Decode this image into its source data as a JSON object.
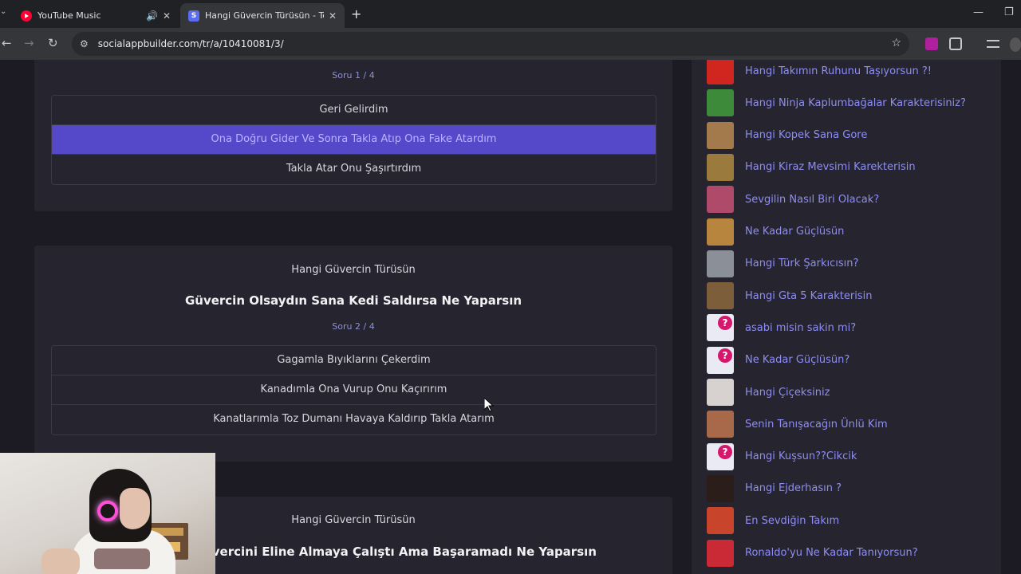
{
  "browser": {
    "tabs": [
      {
        "title": "YouTube Music",
        "icon": "youtube-music-icon",
        "extra_icon": "speaker-icon"
      },
      {
        "title": "Hangi Güvercin Türüsün - Test",
        "icon": "socialappbuilder-icon"
      }
    ],
    "url": "socialappbuilder.com/tr/a/10410081/3/"
  },
  "quiz": {
    "card1": {
      "counter": "Soru 1 / 4",
      "answers": [
        "Geri Gelirdim",
        "Ona Doğru Gider Ve Sonra Takla Atıp Ona Fake Atardım",
        "Takla Atar Onu Şaşırtırdım"
      ],
      "selected_index": 1
    },
    "card2": {
      "app_title": "Hangi Güvercin Türüsün",
      "question": "Güvercin Olsaydın Sana Kedi Saldırsa Ne Yaparsın",
      "counter": "Soru 2 / 4",
      "answers": [
        "Gagamla Bıyıklarını Çekerdim",
        "Kanadımla Ona Vurup Onu Kaçırırım",
        "Kanatlarımla Toz Dumanı Havaya Kaldırıp Takla Atarım"
      ]
    },
    "card3": {
      "app_title": "Hangi Güvercin Türüsün",
      "question": "la Çatıdasın Güvercini Eline Almaya Çalıştı Ama Başaramadı Ne Yaparsın"
    }
  },
  "sidebar": {
    "items": [
      {
        "label": "Hangi Takımın Ruhunu Taşıyorsun ?!",
        "thumb_color": "#d1261f"
      },
      {
        "label": "Hangi Ninja Kaplumbağalar Karakterisiniz?",
        "thumb_color": "#3d8a3a"
      },
      {
        "label": "Hangi Kopek Sana Gore",
        "thumb_color": "#a37a4c"
      },
      {
        "label": "Hangi Kiraz Mevsimi Karekterisin",
        "thumb_color": "#9b7b3d"
      },
      {
        "label": "Sevgilin Nasıl Biri Olacak?",
        "thumb_color": "#b04a6a"
      },
      {
        "label": "Ne Kadar Güçlüsün",
        "thumb_color": "#b8853f"
      },
      {
        "label": "Hangi Türk Şarkıcısın?",
        "thumb_color": "#8b8f98"
      },
      {
        "label": "Hangi Gta 5 Karakterisin",
        "thumb_color": "#7d5e3a"
      },
      {
        "label": "asabi misin sakin mi?",
        "thumb_color": "#eaeaf4",
        "question_badge": true
      },
      {
        "label": "Ne Kadar Güçlüsün?",
        "thumb_color": "#eaeaf4",
        "question_badge": true
      },
      {
        "label": "Hangi Çiçeksiniz",
        "thumb_color": "#d7d2d0"
      },
      {
        "label": "Senin Tanışacağın Ünlü Kim",
        "thumb_color": "#a8684a"
      },
      {
        "label": "Hangi Kuşsun??Cikcik",
        "thumb_color": "#eaeaf4",
        "question_badge": true
      },
      {
        "label": "Hangi Ejderhasın ?",
        "thumb_color": "#2a1d1a"
      },
      {
        "label": "En Sevdiğin Takım",
        "thumb_color": "#c8442a"
      },
      {
        "label": "Ronaldo'yu Ne Kadar Tanıyorsun?",
        "thumb_color": "#c92a35"
      }
    ]
  },
  "colors": {
    "selected_answer_bg": "#5649c9",
    "link_color": "#8e8df5",
    "counter_color": "#8d8fd8"
  }
}
